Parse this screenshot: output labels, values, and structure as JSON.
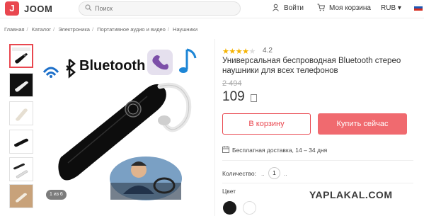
{
  "header": {
    "logo_letter": "J",
    "logo_text": "JOOM",
    "search_placeholder": "Поиск",
    "login_label": "Войти",
    "cart_label": "Моя корзина",
    "currency_label": "RUB ▾"
  },
  "breadcrumb": {
    "items": [
      "Главная",
      "Каталог",
      "Электроника",
      "Портативное аудио и видео",
      "Наушники"
    ]
  },
  "gallery": {
    "counter": "1 из 6",
    "main_image_brand_text": "Bluetooth"
  },
  "product": {
    "stars": "★★★★☆",
    "rating": "4.2",
    "title": "Универсальная беспроводная Bluetooth стерео наушники для всех телефонов",
    "old_price": "2 494",
    "price": "109"
  },
  "actions": {
    "add_to_cart": "В корзину",
    "buy_now": "Купить сейчас"
  },
  "delivery": {
    "text": "Бесплатная доставка, 14 – 34 дня"
  },
  "quantity": {
    "label": "Количество:",
    "minus": "..",
    "value": "1",
    "plus": ".."
  },
  "color": {
    "label": "Цвет",
    "options": [
      "black",
      "white"
    ]
  },
  "watermark": "YAPLAKAL.COM",
  "colors": {
    "accent": "#e9474f",
    "buy_button": "#f06a6f",
    "star": "#f5b301"
  }
}
